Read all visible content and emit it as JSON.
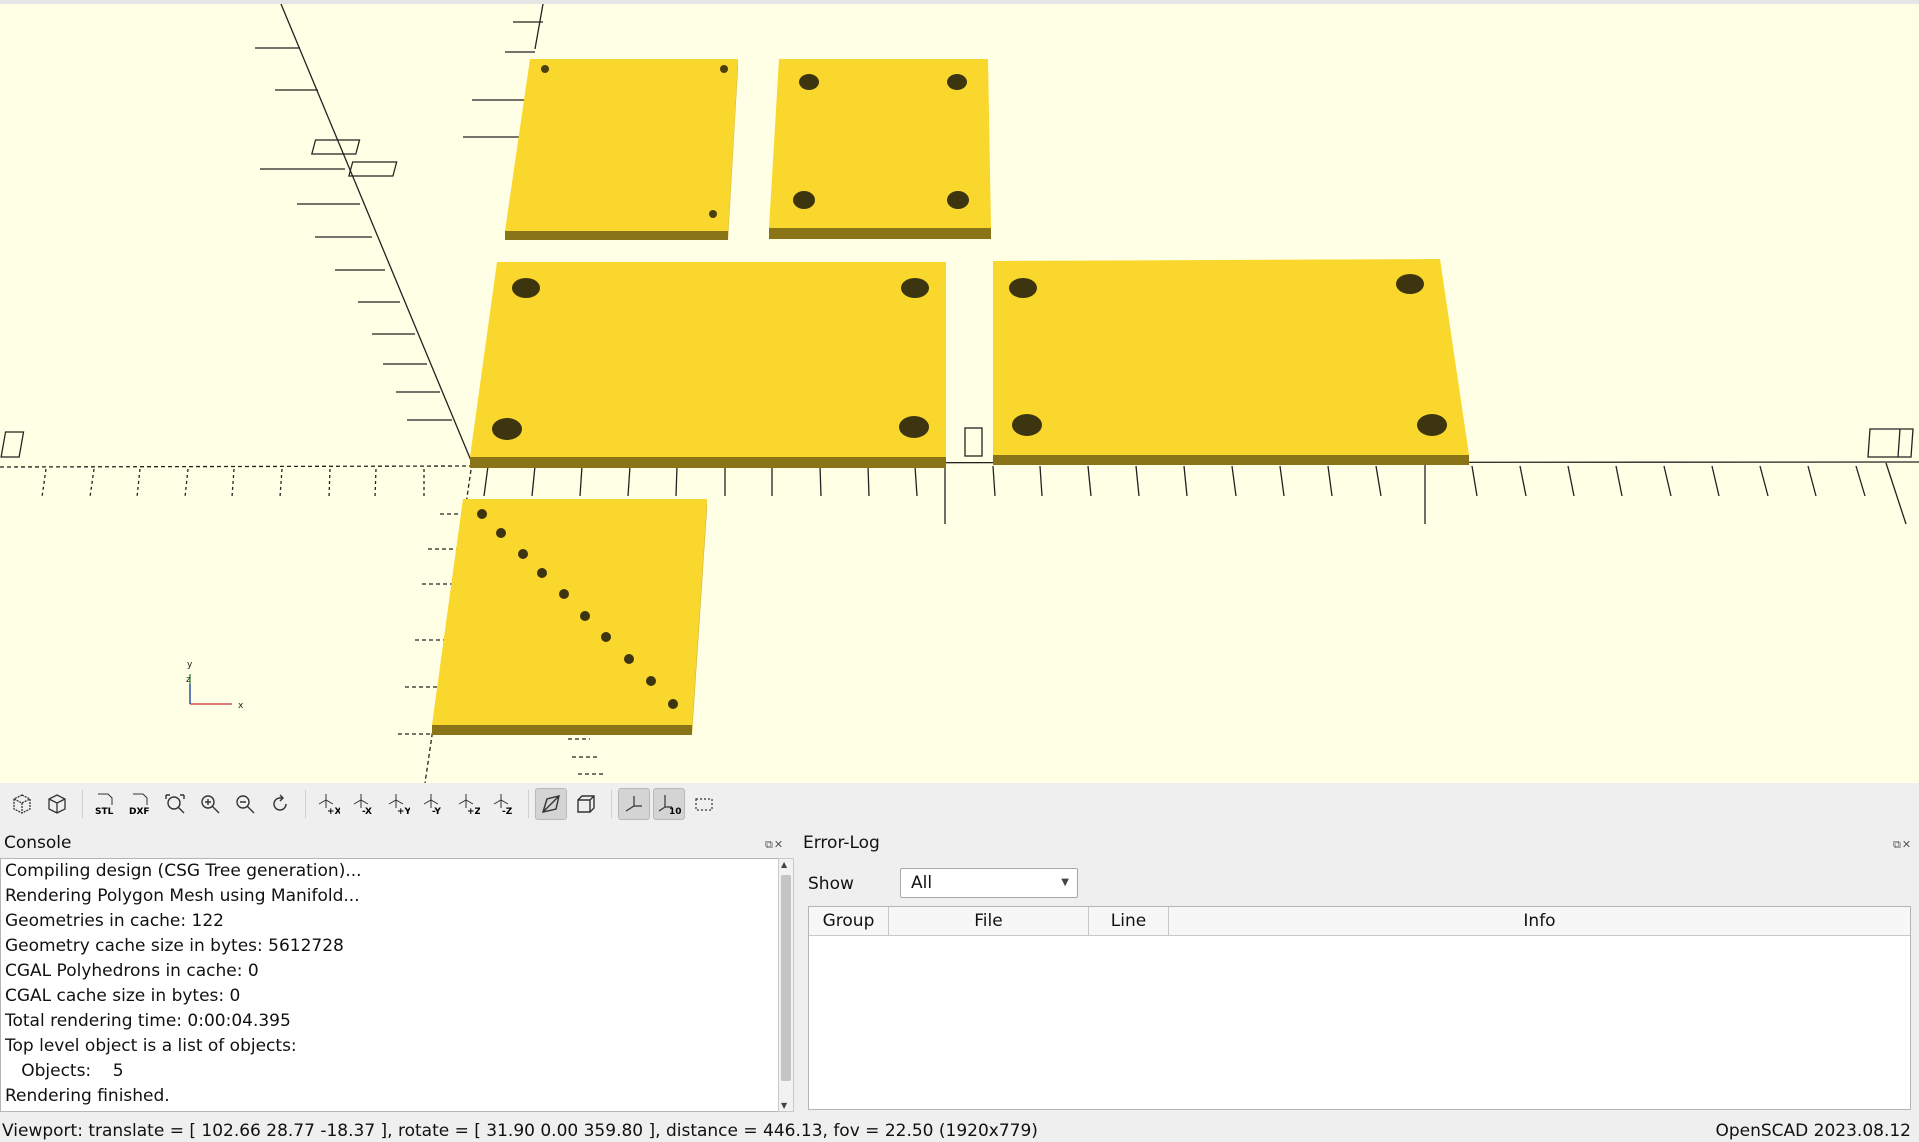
{
  "toolbar": {
    "buttons": [
      {
        "name": "preview-button",
        "icon": "preview-icon"
      },
      {
        "name": "render-button",
        "icon": "render-icon"
      },
      {
        "name": "export-stl-button",
        "icon": "export-stl-icon",
        "label": "STL"
      },
      {
        "name": "export-dxf-button",
        "icon": "export-dxf-icon",
        "label": "DXF"
      },
      {
        "name": "view-all-button",
        "icon": "view-all-icon"
      },
      {
        "name": "zoom-in-button",
        "icon": "zoom-in-icon"
      },
      {
        "name": "zoom-out-button",
        "icon": "zoom-out-icon"
      },
      {
        "name": "reset-view-button",
        "icon": "reset-view-icon"
      },
      {
        "name": "view-right-button",
        "icon": "view-right-icon",
        "label": "+X"
      },
      {
        "name": "view-left-button",
        "icon": "view-left-icon",
        "label": "-X"
      },
      {
        "name": "view-back-button",
        "icon": "view-back-icon",
        "label": "+Y"
      },
      {
        "name": "view-front-button",
        "icon": "view-front-icon",
        "label": "-Y"
      },
      {
        "name": "view-top-button",
        "icon": "view-top-icon",
        "label": "+Z"
      },
      {
        "name": "view-bottom-button",
        "icon": "view-bottom-icon",
        "label": "-Z"
      },
      {
        "name": "perspective-button",
        "icon": "perspective-icon",
        "active": true
      },
      {
        "name": "orthogonal-button",
        "icon": "orthogonal-icon"
      },
      {
        "name": "show-axes-button",
        "icon": "axes-icon",
        "active": true
      },
      {
        "name": "show-scale-markers-button",
        "icon": "scale-markers-icon",
        "active": true,
        "label": "10"
      },
      {
        "name": "show-edges-button",
        "icon": "edges-icon"
      }
    ]
  },
  "console": {
    "title": "Console",
    "lines": [
      "Compiling design (CSG Tree generation)...",
      "Rendering Polygon Mesh using Manifold...",
      "Geometries in cache: 122",
      "Geometry cache size in bytes: 5612728",
      "CGAL Polyhedrons in cache: 0",
      "CGAL cache size in bytes: 0",
      "Total rendering time: 0:00:04.395",
      "Top level object is a list of objects:",
      "   Objects:    5",
      "Rendering finished."
    ]
  },
  "errorlog": {
    "title": "Error-Log",
    "show_label": "Show",
    "show_value": "All",
    "columns": [
      "Group",
      "File",
      "Line",
      "Info"
    ]
  },
  "status": {
    "viewport": "Viewport: translate = [ 102.66 28.77 -18.37 ], rotate = [ 31.90 0.00 359.80 ], distance = 446.13, fov = 22.50 (1920x779)",
    "version": "OpenSCAD 2023.08.12"
  },
  "viewport": {
    "background": "#ffffe5",
    "part_color": "#f9d72c",
    "part_shadow": "#8a7418",
    "axis_label_x": "x",
    "axis_label_y": "y",
    "axis_label_z": "z"
  }
}
